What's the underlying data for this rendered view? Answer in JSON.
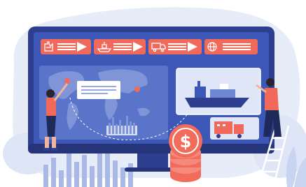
{
  "illustration": {
    "subject": "logistics-dashboard",
    "currency_symbol": "$",
    "colors": {
      "monitor_frame": "#2f3f8f",
      "screen": "#3d57b7",
      "panel": "#5a74c9",
      "accent": "#f0695b",
      "blob_light": "#e3e9f8",
      "bars": "#8ea1db",
      "coin": "#f26b5b",
      "figure_dark": "#1e2a5a"
    },
    "top_tiles": [
      {
        "icon": "factory-icon"
      },
      {
        "icon": "ship-icon"
      },
      {
        "icon": "truck-icon"
      },
      {
        "icon": "globe-icon"
      }
    ]
  }
}
